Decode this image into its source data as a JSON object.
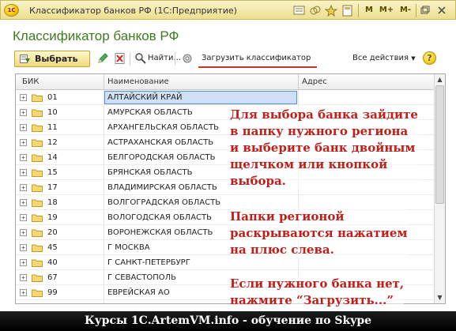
{
  "window": {
    "title": "Классификатор банков РФ  (1С:Предприятие)",
    "logo_text": "1С",
    "controls": [
      "M",
      "M+",
      "M-"
    ]
  },
  "form": {
    "title": "Классификатор банков РФ"
  },
  "toolbar": {
    "select_label": "Выбрать",
    "find_label": "Найти...",
    "load_label": "Загрузить классификатор",
    "all_actions_label": "Все действия",
    "help_label": "?"
  },
  "table": {
    "columns": [
      "БИК",
      "Наименование",
      "Адрес"
    ],
    "rows": [
      {
        "code": "01",
        "name": "АЛТАЙСКИЙ КРАЙ"
      },
      {
        "code": "10",
        "name": "АМУРСКАЯ ОБЛАСТЬ"
      },
      {
        "code": "11",
        "name": "АРХАНГЕЛЬСКАЯ ОБЛАСТЬ"
      },
      {
        "code": "12",
        "name": "АСТРАХАНСКАЯ ОБЛАСТЬ"
      },
      {
        "code": "14",
        "name": "БЕЛГОРОДСКАЯ ОБЛАСТЬ"
      },
      {
        "code": "15",
        "name": "БРЯНСКАЯ ОБЛАСТЬ"
      },
      {
        "code": "17",
        "name": "ВЛАДИМИРСКАЯ ОБЛАСТЬ"
      },
      {
        "code": "18",
        "name": "ВОЛГОГРАДСКАЯ ОБЛАСТЬ"
      },
      {
        "code": "19",
        "name": "ВОЛОГОДСКАЯ ОБЛАСТЬ"
      },
      {
        "code": "20",
        "name": "ВОРОНЕЖСКАЯ ОБЛАСТЬ"
      },
      {
        "code": "45",
        "name": "Г МОСКВА"
      },
      {
        "code": "40",
        "name": "Г САНКТ-ПЕТЕРБУРГ"
      },
      {
        "code": "67",
        "name": "Г СЕВАСТОПОЛЬ"
      },
      {
        "code": "99",
        "name": "ЕВРЕЙСКАЯ АО"
      }
    ],
    "selected_index": 0
  },
  "annotation": {
    "block1": [
      "Для выбора банка зайдите",
      "в папку нужного региона",
      "и выберите банк двойным",
      "щелчком или кнопкой",
      "выбора."
    ],
    "block2": [
      "Папки регионой",
      "раскрываются нажатием",
      "на плюс слева."
    ],
    "block3": [
      "Если нужного банка нет,",
      "нажмите “Загрузить...”"
    ]
  },
  "banner": {
    "text": "Курсы 1С.ArtemVM.info - обучение по Skype"
  },
  "colors": {
    "title_green": "#3f7c1f",
    "annotation_red": "#c0201a",
    "selection_blue": "#cfe0f5"
  }
}
